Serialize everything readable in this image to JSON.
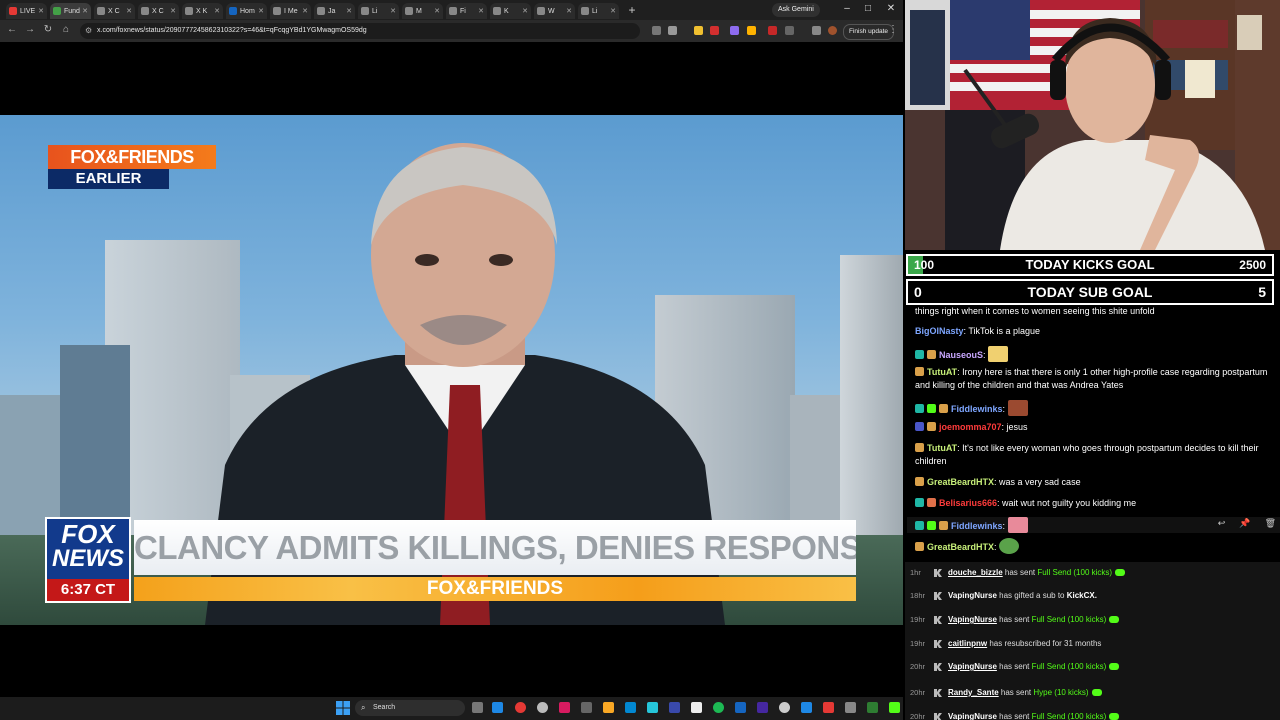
{
  "browser": {
    "tabs": [
      {
        "label": "LIVE",
        "color": "#e53935",
        "active": false
      },
      {
        "label": "Fund",
        "color": "#43a047",
        "active": true
      },
      {
        "label": "X C",
        "color": "#888888",
        "active": false
      },
      {
        "label": "X C",
        "color": "#888888",
        "active": false
      },
      {
        "label": "X K",
        "color": "#888888",
        "active": false
      },
      {
        "label": "Hom",
        "color": "#1565c0",
        "active": false
      },
      {
        "label": "I Me",
        "color": "#888888",
        "active": false
      },
      {
        "label": "Ja",
        "color": "#888888",
        "active": false
      },
      {
        "label": "Li",
        "color": "#888888",
        "active": false
      },
      {
        "label": "M",
        "color": "#888888",
        "active": false
      },
      {
        "label": "Fi",
        "color": "#888888",
        "active": false
      },
      {
        "label": "K",
        "color": "#888888",
        "active": false
      },
      {
        "label": "W",
        "color": "#888888",
        "active": false
      },
      {
        "label": "Li",
        "color": "#888888",
        "active": false
      }
    ],
    "new_tab": "+",
    "ask_gemini": "Ask Gemini",
    "url": "x.com/foxnews/status/2090777245862310322?s=46&t=qFcqgYBd1YGMwagmOS59dg",
    "finish_update": "Finish update"
  },
  "video": {
    "show_logo_top": "FOX&FRIENDS",
    "show_logo_bottom": "EARLIER",
    "network_top": "FOX",
    "network_bottom": "NEWS",
    "time": "6:37 CT",
    "headline": "CLANCY ADMITS KILLINGS, DENIES RESPONSIBILITY",
    "show_bar": "FOX&FRIENDS"
  },
  "taskbar": {
    "search": "Search"
  },
  "goals": {
    "kicks": {
      "current": "100",
      "label": "TODAY KICKS GOAL",
      "target": "2500",
      "progress": 0.04
    },
    "subs": {
      "current": "0",
      "label": "TODAY SUB GOAL",
      "target": "5"
    }
  },
  "chat": {
    "messages": [
      {
        "user": "",
        "user_color": "#ffffff",
        "text": "things right when it comes to women seeing this shite unfold"
      },
      {
        "user": "BigOlNasty",
        "user_color": "#7ea6ff",
        "text": ": TikTok is a plague"
      },
      {
        "user": "NauseouS",
        "user_color": "#c9a8ff",
        "text": ":"
      },
      {
        "user": "TutuAT",
        "user_color": "#c8f07a",
        "text": ": Irony here is that there is only 1 other high-profile case regarding postpartum and killing of the children and that was Andrea Yates"
      },
      {
        "user": "Fiddlewinks",
        "user_color": "#7ea6ff",
        "text": ":"
      },
      {
        "user": "joemomma707",
        "user_color": "#ff3b3b",
        "text": ": jesus"
      },
      {
        "user": "TutuAT",
        "user_color": "#c8f07a",
        "text": ": It's not like every woman who goes through postpartum decides to kill their children"
      },
      {
        "user": "GreatBeardHTX",
        "user_color": "#c8f07a",
        "text": ": was a very sad case"
      },
      {
        "user": "Belisarius666",
        "user_color": "#ff3b3b",
        "text": ": wait wut not guilty you kidding me"
      },
      {
        "user": "Fiddlewinks",
        "user_color": "#7ea6ff",
        "text": ":"
      },
      {
        "user": "GreatBeardHTX",
        "user_color": "#c8f07a",
        "text": ":"
      }
    ]
  },
  "events": [
    {
      "time": "1hr",
      "user": "douche_bizzle",
      "pre": " has sent ",
      "item": "Full Send (100 kicks)",
      "post": "",
      "icon": true
    },
    {
      "time": "18hr",
      "user": "VapingNurse",
      "pre": " has gifted a sub to ",
      "item": "",
      "post": "KickCX.",
      "icon": false
    },
    {
      "time": "19hr",
      "user": "VapingNurse",
      "pre": " has sent ",
      "item": "Full Send (100 kicks)",
      "post": "",
      "icon": true
    },
    {
      "time": "19hr",
      "user": "caitlinpnw",
      "pre": " has resubscribed for 31 months",
      "item": "",
      "post": "",
      "icon": false
    },
    {
      "time": "20hr",
      "user": "VapingNurse",
      "pre": " has sent ",
      "item": "Full Send (100 kicks)",
      "post": "",
      "icon": true
    },
    {
      "time": "20hr",
      "user": "Randy_Sante",
      "pre": " has sent ",
      "item": "Hype (10 kicks)",
      "post": "",
      "icon": true
    },
    {
      "time": "20hr",
      "user": "VapingNurse",
      "pre": " has sent ",
      "item": "Full Send (100 kicks)",
      "post": "",
      "icon": true
    }
  ],
  "colors": {
    "kick_green": "#53fc18",
    "fox_blue": "#123a8c",
    "fox_orange": "#f47b1b"
  }
}
